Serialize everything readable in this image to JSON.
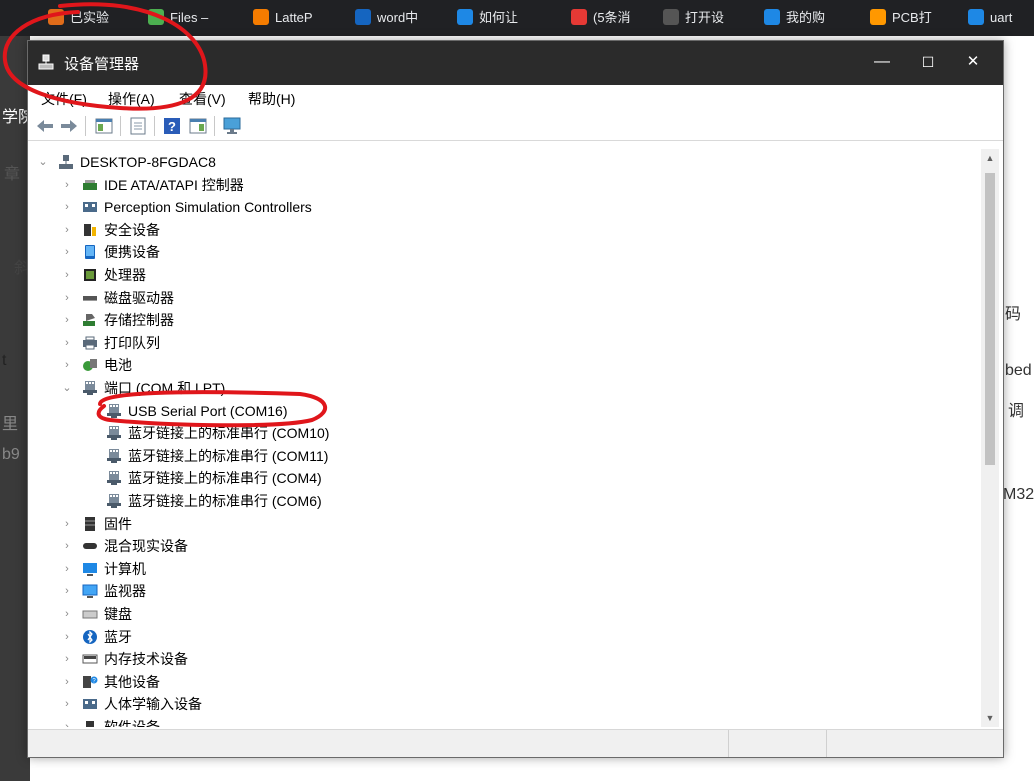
{
  "browser": {
    "tabs": [
      {
        "label": "已实验",
        "icon_color": "#e06c1a"
      },
      {
        "label": "Files –",
        "icon_color": "#4caf50"
      },
      {
        "label": "LatteP",
        "icon_color": "#f57c00"
      },
      {
        "label": "word中",
        "icon_color": "#1565c0"
      },
      {
        "label": "如何让",
        "icon_color": "#1e88e5"
      },
      {
        "label": "(5条消",
        "icon_color": "#e53935"
      },
      {
        "label": "打开设",
        "icon_color": "#555555"
      },
      {
        "label": "我的购",
        "icon_color": "#1e88e5"
      },
      {
        "label": "PCB打",
        "icon_color": "#ff9800"
      },
      {
        "label": "uart",
        "icon_color": "#1e88e5"
      }
    ],
    "bg_fragments": [
      "学院",
      "章",
      "斜",
      "t",
      "里",
      "b9",
      "码",
      "bed",
      "调",
      "M32"
    ]
  },
  "window": {
    "title": "设备管理器",
    "controls": {
      "minimize": "—",
      "maximize": "☐",
      "close": "✕"
    }
  },
  "menu": [
    {
      "label": "文件(F)"
    },
    {
      "label": "操作(A)"
    },
    {
      "label": "查看(V)"
    },
    {
      "label": "帮助(H)"
    }
  ],
  "toolbar": {
    "icons": [
      "back-icon",
      "forward-icon",
      "properties-icon",
      "update-driver-icon",
      "help-icon",
      "view-icon",
      "scan-hardware-icon"
    ]
  },
  "tree": {
    "root": "DESKTOP-8FGDAC8",
    "nodes": [
      {
        "label": "IDE ATA/ATAPI 控制器",
        "icon": "ide-controller-icon",
        "expanded": false
      },
      {
        "label": "Perception Simulation Controllers",
        "icon": "perception-controller-icon",
        "expanded": false
      },
      {
        "label": "安全设备",
        "icon": "security-device-icon",
        "expanded": false
      },
      {
        "label": "便携设备",
        "icon": "portable-device-icon",
        "expanded": false
      },
      {
        "label": "处理器",
        "icon": "processor-icon",
        "expanded": false
      },
      {
        "label": "磁盘驱动器",
        "icon": "disk-drive-icon",
        "expanded": false
      },
      {
        "label": "存储控制器",
        "icon": "storage-controller-icon",
        "expanded": false
      },
      {
        "label": "打印队列",
        "icon": "print-queue-icon",
        "expanded": false
      },
      {
        "label": "电池",
        "icon": "battery-icon",
        "expanded": false
      },
      {
        "label": "端口 (COM 和 LPT)",
        "icon": "port-icon",
        "expanded": true,
        "children": [
          {
            "label": "USB Serial Port (COM16)",
            "icon": "port-icon"
          },
          {
            "label": "蓝牙链接上的标准串行 (COM10)",
            "icon": "port-icon"
          },
          {
            "label": "蓝牙链接上的标准串行 (COM11)",
            "icon": "port-icon"
          },
          {
            "label": "蓝牙链接上的标准串行 (COM4)",
            "icon": "port-icon"
          },
          {
            "label": "蓝牙链接上的标准串行 (COM6)",
            "icon": "port-icon"
          }
        ]
      },
      {
        "label": "固件",
        "icon": "firmware-icon",
        "expanded": false
      },
      {
        "label": "混合现实设备",
        "icon": "mixed-reality-icon",
        "expanded": false
      },
      {
        "label": "计算机",
        "icon": "computer-icon",
        "expanded": false
      },
      {
        "label": "监视器",
        "icon": "monitor-icon",
        "expanded": false
      },
      {
        "label": "键盘",
        "icon": "keyboard-icon",
        "expanded": false
      },
      {
        "label": "蓝牙",
        "icon": "bluetooth-icon",
        "expanded": false
      },
      {
        "label": "内存技术设备",
        "icon": "memory-tech-icon",
        "expanded": false
      },
      {
        "label": "其他设备",
        "icon": "other-device-icon",
        "expanded": false
      },
      {
        "label": "人体学输入设备",
        "icon": "hid-icon",
        "expanded": false
      },
      {
        "label": "软件设备",
        "icon": "software-device-icon",
        "expanded": false
      }
    ]
  },
  "colors": {
    "titlebar": "#2b2b2b",
    "annotation": "#e0161b",
    "highlight": "#cce8ff"
  }
}
